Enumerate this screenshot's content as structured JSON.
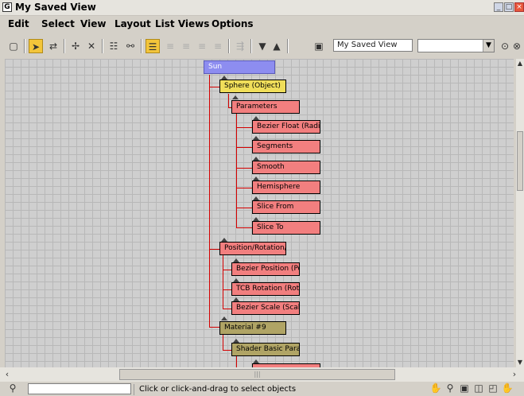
{
  "window": {
    "title": "My Saved View",
    "app_icon_glyph": "G",
    "controls": {
      "minimize": "_",
      "maximize": "□",
      "close": "×"
    }
  },
  "menu": [
    "Edit",
    "Select",
    "View",
    "Layout",
    "List Views",
    "Options"
  ],
  "toolbar": {
    "view_name_field": "My Saved View",
    "combo_value": ""
  },
  "tree": {
    "root": "Sun",
    "nodes": [
      {
        "label": "Sphere (Object)",
        "color": "yellow"
      },
      {
        "label": "Parameters",
        "color": "red"
      },
      {
        "label": "Bezier Float (Radius)",
        "color": "red"
      },
      {
        "label": "Segments",
        "color": "red"
      },
      {
        "label": "Smooth",
        "color": "red"
      },
      {
        "label": "Hemisphere",
        "color": "red"
      },
      {
        "label": "Slice From",
        "color": "red"
      },
      {
        "label": "Slice To",
        "color": "red"
      },
      {
        "label": "Position/Rotation/...",
        "color": "red"
      },
      {
        "label": "Bezier Position (Po...",
        "color": "red"
      },
      {
        "label": "TCB Rotation (Rot...",
        "color": "red"
      },
      {
        "label": "Bezier Scale (Scale)",
        "color": "red"
      },
      {
        "label": "Material #9",
        "color": "olive"
      },
      {
        "label": "Shader Basic Para...",
        "color": "olive"
      }
    ]
  },
  "status": {
    "message": "Click or click-and-drag to select objects"
  },
  "colors": {
    "node_red": "#f27f7f",
    "node_yellow": "#f0de5a",
    "node_olive": "#b0a465",
    "node_root": "#8d8df0",
    "wire": "#d40000"
  }
}
